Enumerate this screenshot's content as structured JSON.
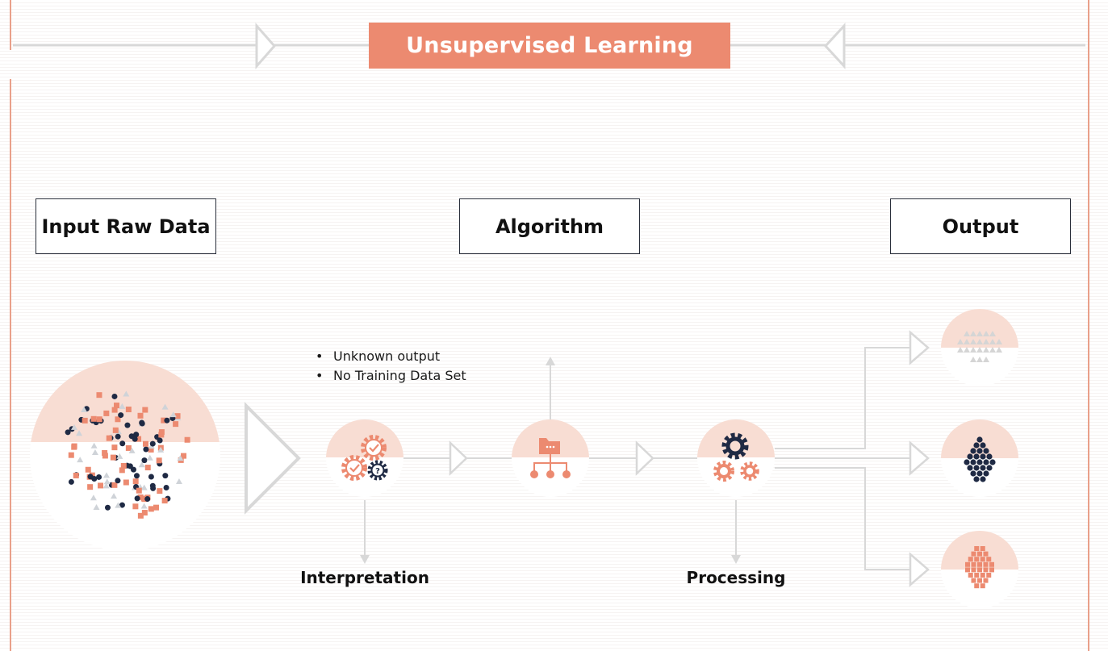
{
  "title": "Unsupervised Learning",
  "stages": {
    "input": "Input Raw Data",
    "algorithm": "Algorithm",
    "output": "Output"
  },
  "notes": [
    "Unknown output",
    "No Training Data Set"
  ],
  "captions": {
    "interpretation": "Interpretation",
    "processing": "Processing"
  },
  "icons": {
    "interpretation": "gears-check-question-icon",
    "algorithm": "folder-hierarchy-icon",
    "processing": "gears-icon",
    "output_1": "triangle-cluster-icon",
    "output_2": "dot-cluster-icon",
    "output_3": "square-cluster-icon"
  },
  "colors": {
    "accent": "#ec8a70",
    "navy": "#1f2a44",
    "grey": "#d8d8d8",
    "blush": "#f8ddd3"
  }
}
